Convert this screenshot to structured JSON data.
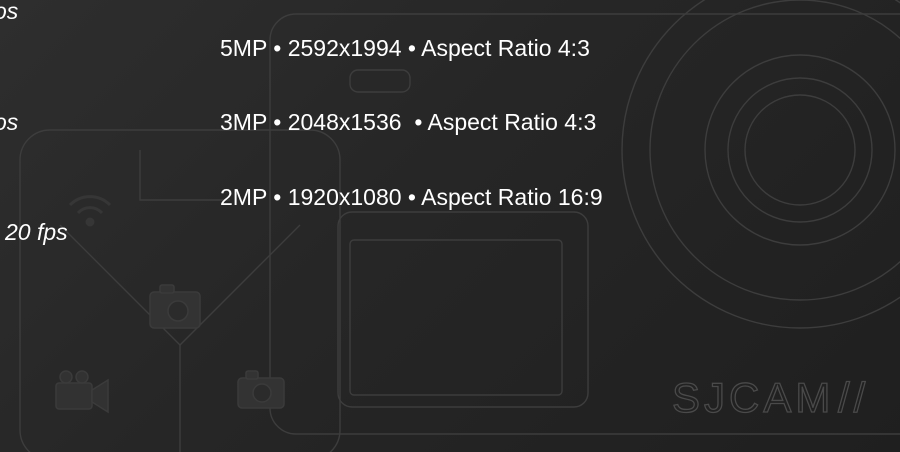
{
  "left_items": [
    {
      "text": "os"
    },
    {
      "text": "os"
    },
    {
      "text": "20 fps"
    }
  ],
  "resolution_options": [
    {
      "text": "5MP • 2592x1994 • Aspect Ratio 4:3"
    },
    {
      "text": "3MP • 2048x1536  • Aspect Ratio 4:3"
    },
    {
      "text": "2MP • 1920x1080 • Aspect Ratio 16:9"
    }
  ],
  "watermark": {
    "brand": "SJCAM",
    "mark": "//"
  },
  "colors": {
    "background": "#252525",
    "text": "#ffffff",
    "outline": "#4a4a4a"
  },
  "icons": [
    "video-camera-icon",
    "photo-camera-icon",
    "wifi-icon",
    "camera-lens-icon"
  ]
}
